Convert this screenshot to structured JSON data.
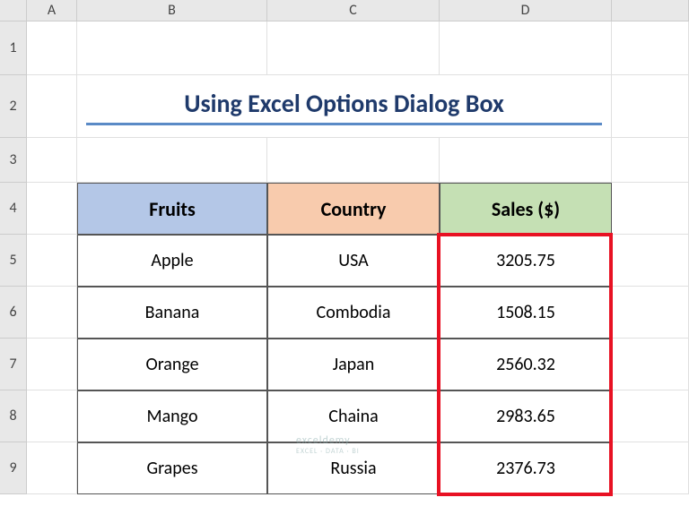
{
  "columns": {
    "A": "A",
    "B": "B",
    "C": "C",
    "D": "D"
  },
  "rows": [
    "1",
    "2",
    "3",
    "4",
    "5",
    "6",
    "7",
    "8",
    "9"
  ],
  "title": "Using Excel Options Dialog Box",
  "headers": {
    "fruits": "Fruits",
    "country": "Country",
    "sales": "Sales ($)"
  },
  "data": [
    {
      "fruit": "Apple",
      "country": "USA",
      "sales": "3205.75"
    },
    {
      "fruit": "Banana",
      "country": "Combodia",
      "sales": "1508.15"
    },
    {
      "fruit": "Orange",
      "country": "Japan",
      "sales": "2560.32"
    },
    {
      "fruit": "Mango",
      "country": "Chaina",
      "sales": "2983.65"
    },
    {
      "fruit": "Grapes",
      "country": "Russia",
      "sales": "2376.73"
    }
  ],
  "watermark": {
    "main": "exceldemy",
    "sub": "EXCEL · DATA · BI"
  },
  "chart_data": {
    "type": "table",
    "title": "Using Excel Options Dialog Box",
    "columns": [
      "Fruits",
      "Country",
      "Sales ($)"
    ],
    "rows": [
      [
        "Apple",
        "USA",
        3205.75
      ],
      [
        "Banana",
        "Combodia",
        1508.15
      ],
      [
        "Orange",
        "Japan",
        2560.32
      ],
      [
        "Mango",
        "Chaina",
        2983.65
      ],
      [
        "Grapes",
        "Russia",
        2376.73
      ]
    ]
  }
}
